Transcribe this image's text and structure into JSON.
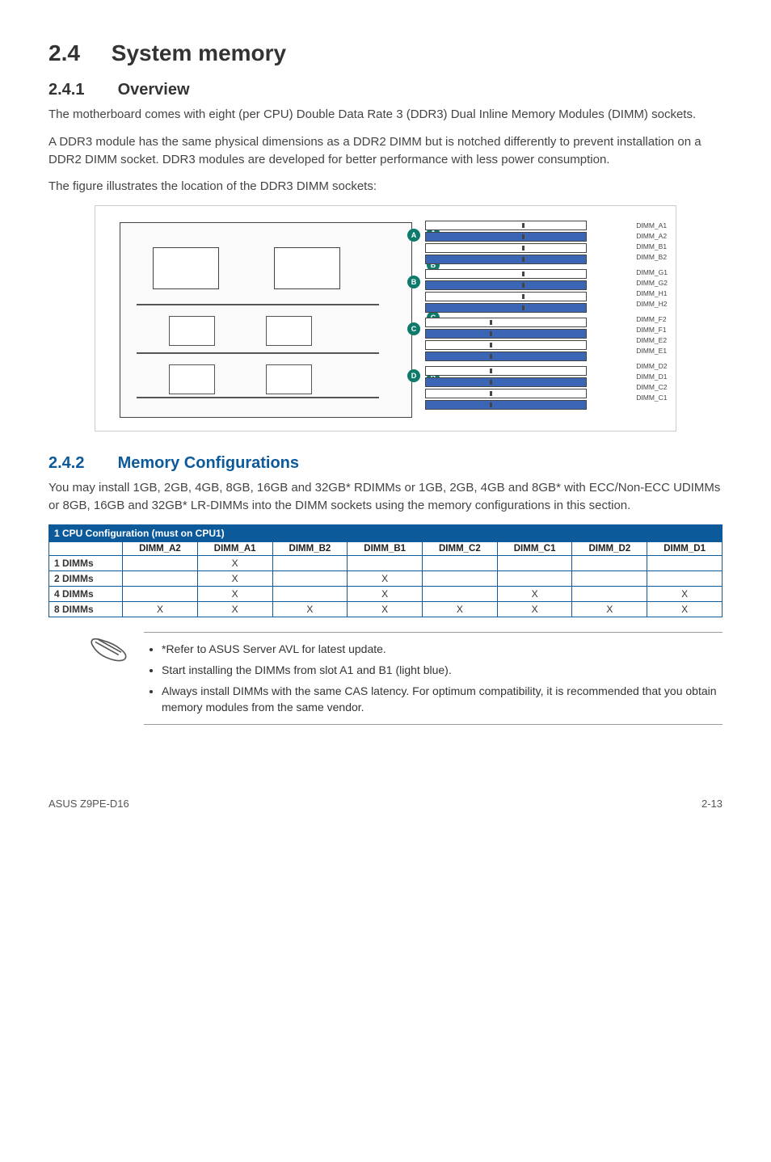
{
  "section": {
    "number": "2.4",
    "title": "System memory"
  },
  "sub1": {
    "number": "2.4.1",
    "title": "Overview",
    "p1": "The motherboard comes with eight (per CPU) Double Data Rate 3 (DDR3) Dual Inline Memory Modules (DIMM) sockets.",
    "p2": "A DDR3 module has the same physical dimensions as a DDR2 DIMM but is notched differently to prevent installation on a DDR2 DIMM socket. DDR3 modules are developed for better performance with less power consumption.",
    "p3": "The figure illustrates the location of the DDR3 DIMM sockets:"
  },
  "dimm_labels": [
    "DIMM_A1",
    "DIMM_A2",
    "DIMM_B1",
    "DIMM_B2",
    "DIMM_G1",
    "DIMM_G2",
    "DIMM_H1",
    "DIMM_H2",
    "DIMM_F2",
    "DIMM_F1",
    "DIMM_E2",
    "DIMM_E1",
    "DIMM_D2",
    "DIMM_D1",
    "DIMM_C2",
    "DIMM_C1"
  ],
  "callouts": [
    "A",
    "B",
    "C",
    "D"
  ],
  "sub2": {
    "number": "2.4.2",
    "title": "Memory Configurations",
    "p1": "You may install 1GB, 2GB, 4GB, 8GB, 16GB and 32GB* RDIMMs or 1GB, 2GB, 4GB and 8GB* with ECC/Non-ECC UDIMMs or 8GB, 16GB and 32GB* LR-DIMMs into the DIMM sockets using the memory configurations in this section."
  },
  "table": {
    "title": "1 CPU Configuration (must on CPU1)",
    "columns": [
      "DIMM_A2",
      "DIMM_A1",
      "DIMM_B2",
      "DIMM_B1",
      "DIMM_C2",
      "DIMM_C1",
      "DIMM_D2",
      "DIMM_D1"
    ],
    "rows": [
      {
        "label": "1 DIMMs",
        "cells": [
          "",
          "X",
          "",
          "",
          "",
          "",
          "",
          ""
        ]
      },
      {
        "label": "2 DIMMs",
        "cells": [
          "",
          "X",
          "",
          "X",
          "",
          "",
          "",
          ""
        ]
      },
      {
        "label": "4 DIMMs",
        "cells": [
          "",
          "X",
          "",
          "X",
          "",
          "X",
          "",
          "X"
        ]
      },
      {
        "label": "8 DIMMs",
        "cells": [
          "X",
          "X",
          "X",
          "X",
          "X",
          "X",
          "X",
          "X"
        ]
      }
    ]
  },
  "notes": {
    "n1": "*Refer to ASUS Server AVL for latest update.",
    "n2": "Start installing the DIMMs from slot A1 and B1 (light blue).",
    "n3": "Always install DIMMs with the same CAS latency. For optimum compatibility, it is recommended that you obtain memory modules from the same vendor."
  },
  "footer": {
    "left": "ASUS Z9PE-D16",
    "right": "2-13"
  }
}
